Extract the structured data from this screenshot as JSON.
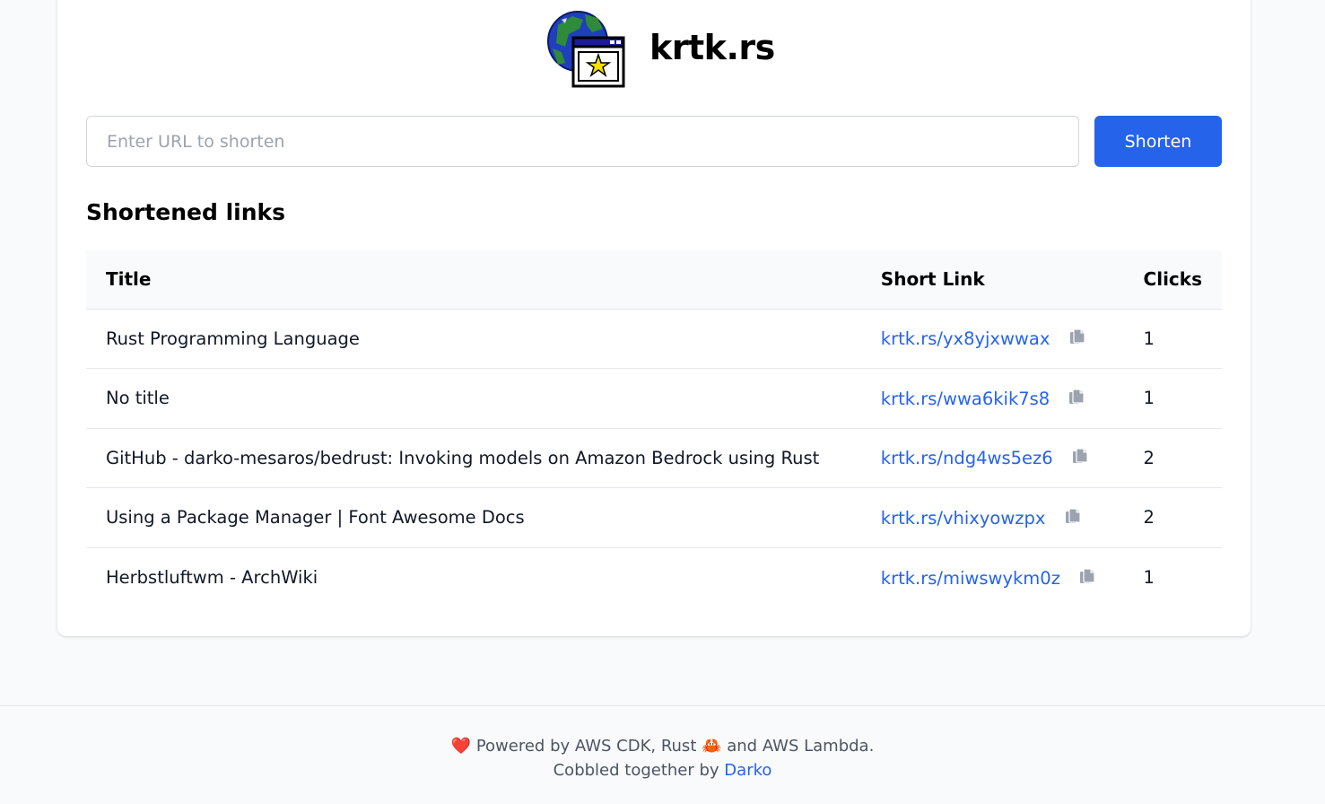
{
  "header": {
    "title": "krtk.rs"
  },
  "form": {
    "url_placeholder": "Enter URL to shorten",
    "url_value": "",
    "submit_label": "Shorten"
  },
  "links": {
    "section_title": "Shortened links",
    "columns": [
      "Title",
      "Short Link",
      "Clicks"
    ],
    "rows": [
      {
        "title": "Rust Programming Language",
        "short_link": "krtk.rs/yx8yjxwwax",
        "clicks": "1"
      },
      {
        "title": "No title",
        "short_link": "krtk.rs/wwa6kik7s8",
        "clicks": "1"
      },
      {
        "title": "GitHub - darko-mesaros/bedrust: Invoking models on Amazon Bedrock using Rust",
        "short_link": "krtk.rs/ndg4ws5ez6",
        "clicks": "2"
      },
      {
        "title": "Using a Package Manager | Font Awesome Docs",
        "short_link": "krtk.rs/vhixyowzpx",
        "clicks": "2"
      },
      {
        "title": "Herbstluftwm - ArchWiki",
        "short_link": "krtk.rs/miwswykm0z",
        "clicks": "1"
      }
    ],
    "copy_icon": "copy-icon"
  },
  "footer": {
    "heart": "❤️",
    "powered_prefix": " Powered by AWS CDK, Rust ",
    "crab": "🦀",
    "powered_suffix": " and AWS Lambda.",
    "cobbled_prefix": "Cobbled together by ",
    "author": "Darko"
  },
  "colors": {
    "accent": "#2563eb",
    "background": "#f9fafb",
    "copy_icon": "#9ca3af"
  }
}
